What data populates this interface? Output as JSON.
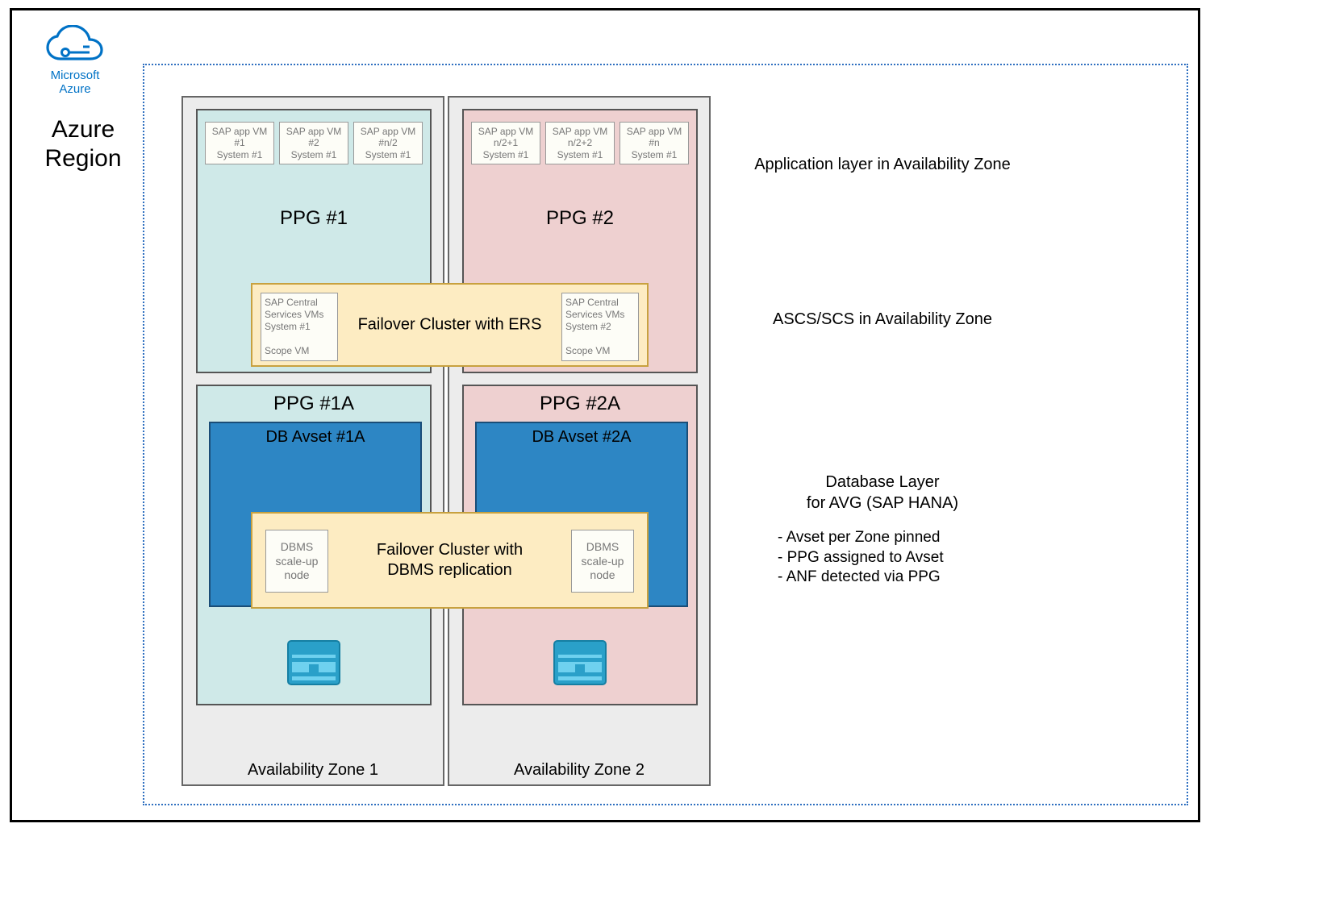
{
  "title": "Azure Region",
  "logo_text": "Microsoft\nAzure",
  "zones": {
    "z1": {
      "label": "Availability Zone 1"
    },
    "z2": {
      "label": "Availability Zone 2"
    }
  },
  "ppg": {
    "p1": {
      "title": "PPG #1"
    },
    "p2": {
      "title": "PPG #2"
    },
    "p1a": {
      "title": "PPG #1A"
    },
    "p2a": {
      "title": "PPG #2A"
    }
  },
  "vms_z1": [
    {
      "l1": "SAP app VM",
      "l2": "#1",
      "l3": "System #1"
    },
    {
      "l1": "SAP app VM",
      "l2": "#2",
      "l3": "System #1"
    },
    {
      "l1": "SAP app VM",
      "l2": "#n/2",
      "l3": "System #1"
    }
  ],
  "vms_z2": [
    {
      "l1": "SAP app VM",
      "l2": "n/2+1",
      "l3": "System #1"
    },
    {
      "l1": "SAP app VM",
      "l2": "n/2+2",
      "l3": "System #1"
    },
    {
      "l1": "SAP app VM",
      "l2": "#n",
      "l3": "System #1"
    }
  ],
  "failover_ers": {
    "label": "Failover Cluster with ERS",
    "left": {
      "l1": "SAP Central",
      "l2": "Services VMs",
      "l3": "System #1",
      "l4": "Scope VM"
    },
    "right": {
      "l1": "SAP Central",
      "l2": "Services VMs",
      "l3": "System #2",
      "l4": "Scope VM"
    }
  },
  "db_avset": {
    "a1": "DB Avset #1A",
    "a2": "DB Avset #2A"
  },
  "failover_db": {
    "label": "Failover Cluster with DBMS replication",
    "left": {
      "l1": "DBMS",
      "l2": "scale-up",
      "l3": "node"
    },
    "right": {
      "l1": "DBMS",
      "l2": "scale-up",
      "l3": "node"
    }
  },
  "annotations": {
    "app_layer": "Application layer in Availability Zone",
    "ascs": "ASCS/SCS in Availability Zone",
    "db_layer_title": "Database Layer\nfor AVG (SAP HANA)",
    "db_layer_items": [
      "Avset per Zone pinned",
      "PPG assigned to Avset",
      "ANF detected via PPG"
    ]
  }
}
